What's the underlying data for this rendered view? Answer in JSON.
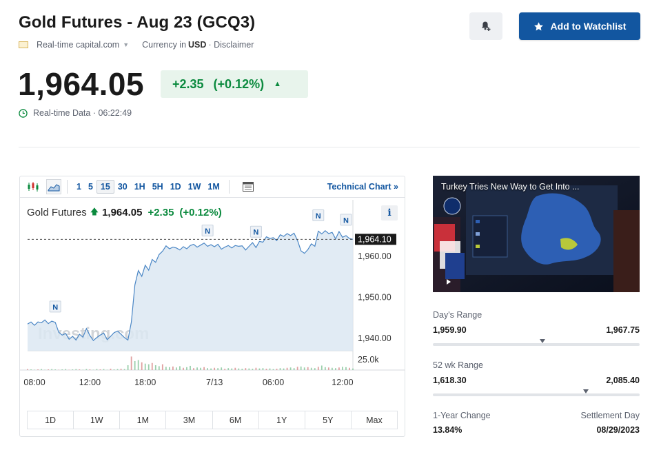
{
  "header": {
    "title": "Gold Futures - Aug 23 (GCQ3)",
    "source": "Real-time capital.com",
    "currency_prefix": "Currency in",
    "currency": "USD",
    "disclaimer": "· Disclaimer",
    "watchlist_label": "Add to Watchlist"
  },
  "quote": {
    "price": "1,964.05",
    "change": "+2.35",
    "change_pct": "(+0.12%)",
    "realtime": "Real-time Data · 06:22:49"
  },
  "colors": {
    "accent": "#1256a0",
    "positive": "#0b8a3e",
    "positive_bg": "#e8f4ec"
  },
  "chart_toolbar": {
    "intervals": [
      "1",
      "5",
      "15",
      "30",
      "1H",
      "5H",
      "1D",
      "1W",
      "1M"
    ],
    "selected_interval": "15",
    "technical_chart": "Technical Chart »"
  },
  "chart_data": {
    "type": "line",
    "legend_name": "Gold Futures",
    "last_value": "1,964.05",
    "change": "+2.35",
    "change_pct": "(+0.12%)",
    "current_price_label": "1,964.10",
    "current_price": 1964.1,
    "y_ticks": [
      1960,
      1950,
      1940
    ],
    "y_tick_labels": [
      "1,960.00",
      "1,950.00",
      "1,940.00"
    ],
    "ylim": [
      1937,
      1967
    ],
    "x_tick_labels": [
      "08:00",
      "12:00",
      "18:00",
      "7/13",
      "06:00",
      "12:00"
    ],
    "x_tick_index": [
      2,
      18,
      34,
      54,
      71,
      91
    ],
    "volume_label": "25.0k",
    "watermark": "Investing.com",
    "news_marker_label": "N",
    "news_marker_index": [
      8,
      52,
      66,
      84,
      92
    ],
    "price": [
      1943.5,
      1944,
      1943.2,
      1944,
      1943.8,
      1944.5,
      1943.6,
      1944.2,
      1943.9,
      1941.5,
      1940.8,
      1941.2,
      1939.8,
      1940.5,
      1939.6,
      1941,
      1940.3,
      1942.4,
      1940.7,
      1939.5,
      1940.2,
      1940.8,
      1941.3,
      1939.7,
      1940.5,
      1941.4,
      1941.8,
      1941.0,
      1940.2,
      1939.6,
      1944,
      1953,
      1956.5,
      1955.1,
      1957.8,
      1956.6,
      1959.2,
      1958.5,
      1960.4,
      1961.2,
      1962.5,
      1961.8,
      1962.2,
      1962.0,
      1961.5,
      1962.3,
      1961.8,
      1962.6,
      1962.9,
      1962.2,
      1962.7,
      1963.2,
      1962.4,
      1962.8,
      1962.3,
      1962.9,
      1961.7,
      1962.2,
      1962.6,
      1962.0,
      1962.6,
      1962.4,
      1962.5,
      1961.5,
      1962.4,
      1963.3,
      1962.1,
      1963.6,
      1963.4,
      1964.7,
      1964.3,
      1964.5,
      1963.8,
      1965.2,
      1964.8,
      1965.5,
      1965.0,
      1965.6,
      1963.8,
      1961.3,
      1960.7,
      1961.6,
      1963.0,
      1962.4,
      1966.1,
      1965.4,
      1966.2,
      1965.5,
      1965.8,
      1964.2,
      1966.0,
      1964.6,
      1965.0,
      1964.3,
      1964.1
    ],
    "volume": [
      0.3,
      0.2,
      0.1,
      0.2,
      0.3,
      0.1,
      0.2,
      0.3,
      0.2,
      0.1,
      0.2,
      0.3,
      0.1,
      0.2,
      0.3,
      0.2,
      0.1,
      0.3,
      0.2,
      0.1,
      0.3,
      0.2,
      0.3,
      0.1,
      0.4,
      0.2,
      0.3,
      0.4,
      0.3,
      1.5,
      4.2,
      2.8,
      3.1,
      2.4,
      2.0,
      1.8,
      2.2,
      1.5,
      1.2,
      1.8,
      1.0,
      0.9,
      1.1,
      0.8,
      1.2,
      0.7,
      0.9,
      1.3,
      0.6,
      0.8,
      0.7,
      0.9,
      0.6,
      0.5,
      0.7,
      0.6,
      0.8,
      0.4,
      0.6,
      0.5,
      0.7,
      0.5,
      0.4,
      0.6,
      0.5,
      0.4,
      0.7,
      0.5,
      0.6,
      0.4,
      0.5,
      0.3,
      0.4,
      0.6,
      0.5,
      0.7,
      0.8,
      0.6,
      1.0,
      1.1,
      0.8,
      0.9,
      0.7,
      0.6,
      1.0,
      1.4,
      0.9,
      0.8,
      0.7,
      0.6,
      0.8,
      1.0,
      0.9,
      0.7,
      0.5
    ],
    "volume_ymax": 4.5,
    "grid": false
  },
  "range_buttons": [
    "1D",
    "1W",
    "1M",
    "3M",
    "6M",
    "1Y",
    "5Y",
    "Max"
  ],
  "video": {
    "title": "Turkey Tries New Way to Get Into ..."
  },
  "stats": {
    "days_range": {
      "label": "Day's Range",
      "low": "1,959.90",
      "high": "1,967.75",
      "marker_fraction": 0.53
    },
    "wk52_range": {
      "label": "52 wk Range",
      "low": "1,618.30",
      "high": "2,085.40",
      "marker_fraction": 0.74
    },
    "one_year_change": {
      "label": "1-Year Change",
      "value": "13.84%"
    },
    "settlement_day": {
      "label": "Settlement Day",
      "value": "08/29/2023"
    }
  }
}
